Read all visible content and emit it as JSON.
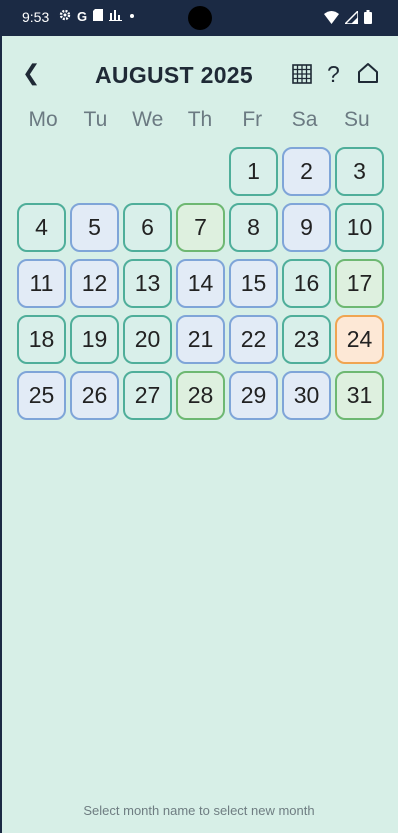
{
  "status": {
    "time": "9:53",
    "left_icons": [
      "gear-icon",
      "google-icon",
      "sd-card-icon",
      "chart-icon",
      "dot-icon"
    ],
    "right_icons": [
      "wifi-icon",
      "signal-icon",
      "battery-icon"
    ]
  },
  "header": {
    "back": "❮",
    "title": "AUGUST 2025",
    "help": "?"
  },
  "weekdays": [
    "Mo",
    "Tu",
    "We",
    "Th",
    "Fr",
    "Sa",
    "Su"
  ],
  "days": [
    {
      "label": "",
      "style": "empty"
    },
    {
      "label": "",
      "style": "empty"
    },
    {
      "label": "",
      "style": "empty"
    },
    {
      "label": "",
      "style": "empty"
    },
    {
      "label": "1",
      "style": "teal"
    },
    {
      "label": "2",
      "style": "blue"
    },
    {
      "label": "3",
      "style": "teal"
    },
    {
      "label": "4",
      "style": "teal"
    },
    {
      "label": "5",
      "style": "blue"
    },
    {
      "label": "6",
      "style": "teal"
    },
    {
      "label": "7",
      "style": "green"
    },
    {
      "label": "8",
      "style": "teal"
    },
    {
      "label": "9",
      "style": "blue"
    },
    {
      "label": "10",
      "style": "teal"
    },
    {
      "label": "11",
      "style": "blue"
    },
    {
      "label": "12",
      "style": "blue"
    },
    {
      "label": "13",
      "style": "teal"
    },
    {
      "label": "14",
      "style": "blue"
    },
    {
      "label": "15",
      "style": "blue"
    },
    {
      "label": "16",
      "style": "teal"
    },
    {
      "label": "17",
      "style": "green"
    },
    {
      "label": "18",
      "style": "teal"
    },
    {
      "label": "19",
      "style": "teal"
    },
    {
      "label": "20",
      "style": "teal"
    },
    {
      "label": "21",
      "style": "blue"
    },
    {
      "label": "22",
      "style": "blue"
    },
    {
      "label": "23",
      "style": "teal"
    },
    {
      "label": "24",
      "style": "orange"
    },
    {
      "label": "25",
      "style": "blue"
    },
    {
      "label": "26",
      "style": "blue"
    },
    {
      "label": "27",
      "style": "teal"
    },
    {
      "label": "28",
      "style": "green"
    },
    {
      "label": "29",
      "style": "blue"
    },
    {
      "label": "30",
      "style": "blue"
    },
    {
      "label": "31",
      "style": "green"
    }
  ],
  "colors": {
    "teal": "#4fae9a",
    "blue": "#7fa5d8",
    "green": "#6eb872",
    "orange_today": "#f0a552",
    "background": "#d7efe7",
    "status_bar": "#1b2a44"
  },
  "footer": {
    "hint": "Select month name to select new month"
  }
}
